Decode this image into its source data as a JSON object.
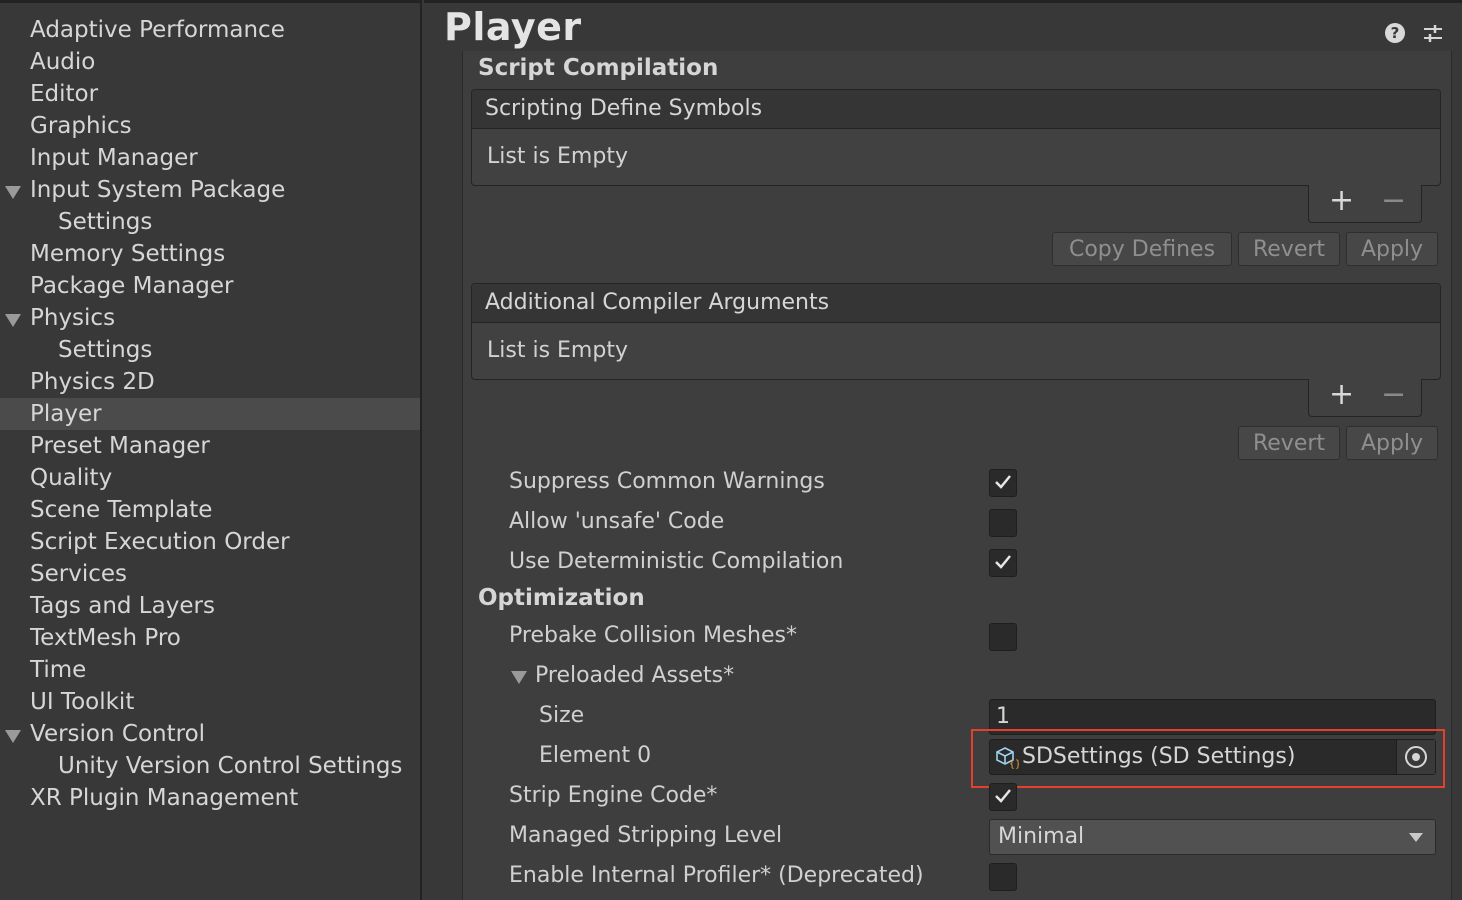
{
  "sidebar": {
    "items": [
      {
        "label": "Adaptive Performance"
      },
      {
        "label": "Audio"
      },
      {
        "label": "Editor"
      },
      {
        "label": "Graphics"
      },
      {
        "label": "Input Manager"
      },
      {
        "label": "Input System Package"
      },
      {
        "label": "Settings"
      },
      {
        "label": "Memory Settings"
      },
      {
        "label": "Package Manager"
      },
      {
        "label": "Physics"
      },
      {
        "label": "Settings"
      },
      {
        "label": "Physics 2D"
      },
      {
        "label": "Player"
      },
      {
        "label": "Preset Manager"
      },
      {
        "label": "Quality"
      },
      {
        "label": "Scene Template"
      },
      {
        "label": "Script Execution Order"
      },
      {
        "label": "Services"
      },
      {
        "label": "Tags and Layers"
      },
      {
        "label": "TextMesh Pro"
      },
      {
        "label": "Time"
      },
      {
        "label": "UI Toolkit"
      },
      {
        "label": "Version Control"
      },
      {
        "label": "Unity Version Control Settings"
      },
      {
        "label": "XR Plugin Management"
      }
    ],
    "selected": "Player"
  },
  "header": {
    "title": "Player",
    "help_icon": "?"
  },
  "script_compilation": {
    "title": "Script Compilation",
    "define_symbols": {
      "header": "Scripting Define Symbols",
      "empty_text": "List is Empty",
      "plus": "+",
      "minus": "−",
      "copy_defines": "Copy Defines",
      "revert": "Revert",
      "apply": "Apply"
    },
    "compiler_args": {
      "header": "Additional Compiler Arguments",
      "empty_text": "List is Empty",
      "plus": "+",
      "minus": "−",
      "revert": "Revert",
      "apply": "Apply"
    },
    "suppress_warnings": {
      "label": "Suppress Common Warnings",
      "checked": true
    },
    "allow_unsafe": {
      "label": "Allow 'unsafe' Code",
      "checked": false
    },
    "deterministic": {
      "label": "Use Deterministic Compilation",
      "checked": true
    }
  },
  "optimization": {
    "title": "Optimization",
    "prebake": {
      "label": "Prebake Collision Meshes*",
      "checked": false
    },
    "preloaded_assets": {
      "label": "Preloaded Assets*",
      "size_label": "Size",
      "size_value": "1",
      "element0_label": "Element 0",
      "element0_value": "SDSettings (SD Settings)"
    },
    "strip_engine": {
      "label": "Strip Engine Code*",
      "checked": true
    },
    "stripping_level": {
      "label": "Managed Stripping Level",
      "value": "Minimal"
    },
    "internal_profiler": {
      "label": "Enable Internal Profiler* (Deprecated)",
      "checked": false
    }
  },
  "colors": {
    "highlight": "#e2412e",
    "background": "#383838"
  }
}
